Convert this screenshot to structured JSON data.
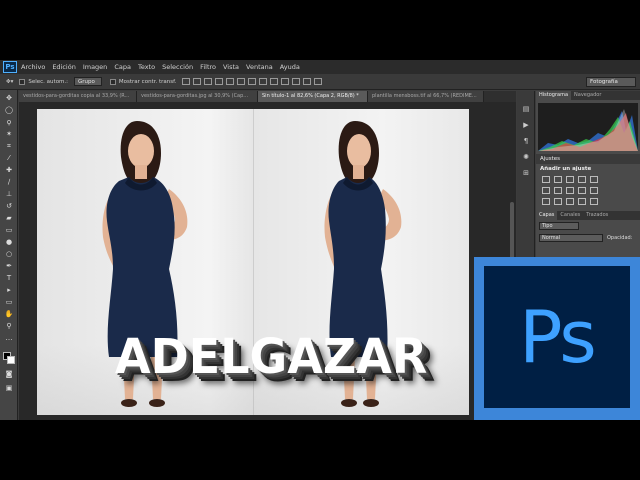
{
  "app": {
    "logo": "Ps"
  },
  "menu": [
    "Archivo",
    "Edición",
    "Imagen",
    "Capa",
    "Texto",
    "Selección",
    "Filtro",
    "Vista",
    "Ventana",
    "Ayuda"
  ],
  "options": {
    "auto_select_label": "Selec. autom.:",
    "auto_select_value": "Grupo",
    "transform_label": "Mostrar contr. transf.",
    "workspace": "Fotografía"
  },
  "tabs": [
    {
      "label": "vestidos-para-gorditas copia al 33,9% (R..."
    },
    {
      "label": "vestidos-para-gorditas.jpg al 30,9% (Cap..."
    },
    {
      "label": "Sin título-1 al 82,6% (Capa 2, RGB/8) *"
    },
    {
      "label": "plantilla mensboss.tif al 66,7% (REDIME..."
    }
  ],
  "canvas": {
    "headline": "ADELGAZAR"
  },
  "panels": {
    "histogram_tab": "Histograma",
    "navigator_tab": "Navegador",
    "adjustments_title": "Ajustes",
    "add_adjustment": "Añadir un ajuste",
    "layers_tab": "Capas",
    "channels_tab": "Canales",
    "paths_tab": "Trazados",
    "kind_filter": "Tipo",
    "blend_mode": "Normal",
    "opacity_label": "Opacidad:"
  },
  "overlay": {
    "ps_logo": "Ps"
  },
  "colors": {
    "ps_blue": "#3d86d9",
    "ps_dark": "#001f44",
    "dress": "#1a2a4a"
  }
}
